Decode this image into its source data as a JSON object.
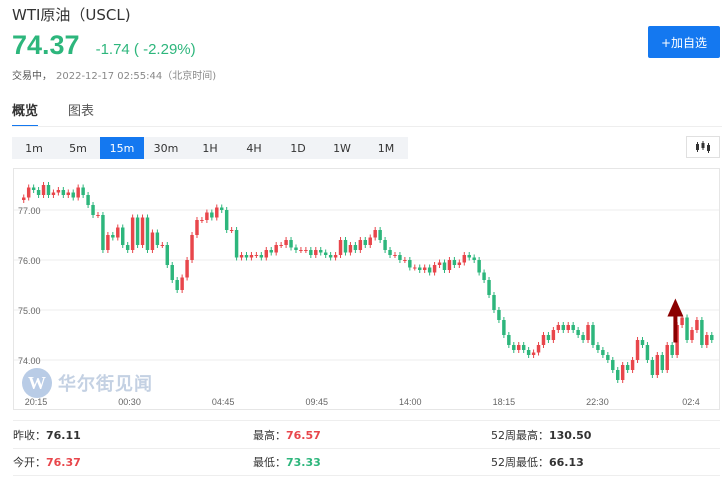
{
  "header": {
    "title": "WTI原油（USCL)",
    "price": "74.37",
    "change": "-1.74 ( -2.29%)",
    "status": "交易中，",
    "timestamp": "2022-12-17 02:55:44（北京时间)",
    "add_button": "+加自选"
  },
  "tabs": [
    {
      "label": "概览",
      "active": true
    },
    {
      "label": "图表",
      "active": false
    }
  ],
  "ranges": [
    {
      "label": "1m",
      "active": false
    },
    {
      "label": "5m",
      "active": false
    },
    {
      "label": "15m",
      "active": true
    },
    {
      "label": "30m",
      "active": false
    },
    {
      "label": "1H",
      "active": false
    },
    {
      "label": "4H",
      "active": false
    },
    {
      "label": "1D",
      "active": false
    },
    {
      "label": "1W",
      "active": false
    },
    {
      "label": "1M",
      "active": false
    }
  ],
  "watermark": "华尔街见闻",
  "colors": {
    "up": "#e8464b",
    "down": "#2db67c",
    "accent": "#1478f0",
    "arrow": "#8b0000"
  },
  "chart_data": {
    "type": "candlestick",
    "y_ticks": [
      "77.00",
      "76.00",
      "75.00",
      "74.00"
    ],
    "x_ticks": [
      "20:15",
      "00:30",
      "04:45",
      "09:45",
      "14:00",
      "18:15",
      "22:30",
      "02:4"
    ],
    "ylim": [
      73.3,
      77.7
    ],
    "grid": true,
    "annotation": "up-arrow",
    "closes": [
      77.25,
      77.45,
      77.4,
      77.3,
      77.5,
      77.3,
      77.35,
      77.4,
      77.3,
      77.35,
      77.25,
      77.45,
      77.3,
      77.1,
      76.9,
      76.9,
      76.2,
      76.5,
      76.45,
      76.65,
      76.3,
      76.2,
      76.85,
      76.3,
      76.85,
      76.2,
      76.55,
      76.3,
      76.3,
      75.9,
      75.6,
      75.4,
      75.65,
      76.0,
      76.5,
      76.8,
      76.8,
      76.95,
      76.85,
      77.05,
      77.0,
      76.6,
      76.6,
      76.05,
      76.1,
      76.05,
      76.1,
      76.1,
      76.05,
      76.2,
      76.15,
      76.3,
      76.3,
      76.4,
      76.25,
      76.2,
      76.2,
      76.2,
      76.1,
      76.2,
      76.15,
      76.1,
      76.05,
      76.1,
      76.4,
      76.15,
      76.3,
      76.2,
      76.4,
      76.3,
      76.45,
      76.6,
      76.4,
      76.2,
      76.1,
      76.1,
      76.0,
      76.0,
      75.85,
      75.85,
      75.8,
      75.85,
      75.75,
      75.9,
      75.95,
      75.8,
      76.0,
      75.9,
      75.95,
      76.1,
      76.05,
      76.0,
      75.75,
      75.6,
      75.3,
      75.0,
      74.8,
      74.5,
      74.3,
      74.2,
      74.3,
      74.2,
      74.1,
      74.15,
      74.3,
      74.5,
      74.4,
      74.6,
      74.7,
      74.6,
      74.7,
      74.6,
      74.5,
      74.4,
      74.7,
      74.3,
      74.2,
      74.1,
      74.0,
      73.8,
      73.6,
      73.9,
      73.8,
      74.0,
      74.4,
      74.3,
      74.0,
      73.7,
      74.1,
      73.8,
      74.3,
      74.1,
      74.7,
      74.85,
      74.4,
      74.6,
      74.8,
      74.3,
      74.5,
      74.4
    ]
  },
  "stats": [
    [
      {
        "label": "昨收：",
        "value": "76.11",
        "tone": "plain"
      },
      {
        "label": "最高：",
        "value": "76.57",
        "tone": "red"
      },
      {
        "label": "52周最高：",
        "value": "130.50",
        "tone": "plain"
      }
    ],
    [
      {
        "label": "今开：",
        "value": "76.37",
        "tone": "red"
      },
      {
        "label": "最低：",
        "value": "73.33",
        "tone": "green"
      },
      {
        "label": "52周最低：",
        "value": "66.13",
        "tone": "plain"
      }
    ]
  ]
}
